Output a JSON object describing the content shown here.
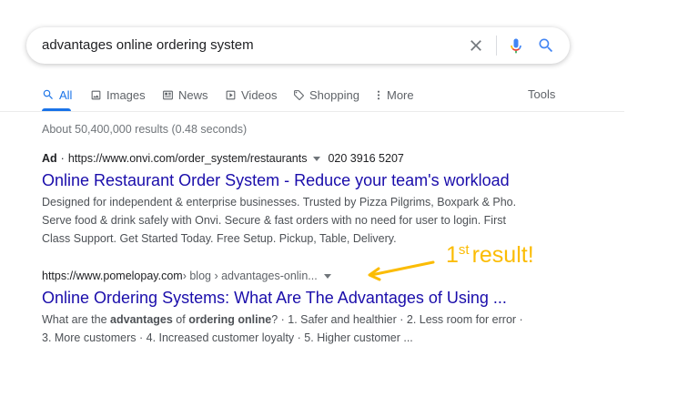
{
  "search": {
    "query": "advantages online ordering system"
  },
  "tabs": [
    {
      "label": "All",
      "icon": "search-icon"
    },
    {
      "label": "Images",
      "icon": "image-icon"
    },
    {
      "label": "News",
      "icon": "news-icon"
    },
    {
      "label": "Videos",
      "icon": "video-icon"
    },
    {
      "label": "Shopping",
      "icon": "tag-icon"
    },
    {
      "label": "More",
      "icon": "more-vert-icon"
    }
  ],
  "tools_label": "Tools",
  "stats": "About 50,400,000 results (0.48 seconds)",
  "ad_result": {
    "ad_label": "Ad",
    "url": "https://www.onvi.com/order_system/restaurants",
    "phone": "020 3916 5207",
    "title": "Online Restaurant Order System - Reduce your team's workload",
    "desc_line1": "Designed for independent & enterprise businesses. Trusted by Pizza Pilgrims, Boxpark & Pho.",
    "desc_line2": "Serve food & drink safely with Onvi. Secure & fast orders with no need for user to login. First",
    "desc_line3": "Class Support. Get Started Today. Free Setup. Pickup, Table, Delivery."
  },
  "organic_result": {
    "domain": "https://www.pomelopay.com",
    "path": " › blog › advantages-onlin...",
    "title": "Online Ordering Systems: What Are The Advantages of Using ...",
    "desc_a": "What are the ",
    "desc_b": "advantages",
    "desc_c": " of ",
    "desc_d": "ordering online",
    "desc_e": "? · 1. Safer and healthier · 2. Less room for error ·",
    "desc_line2": "3. More customers · 4. Increased customer loyalty · 5. Higher customer ..."
  },
  "annotation": {
    "num": "1",
    "sup": "st",
    "text": "result!",
    "color": "#fbbc04"
  },
  "colors": {
    "link": "#1a0dab",
    "accent": "#1a73e8",
    "muted": "#70757a"
  }
}
